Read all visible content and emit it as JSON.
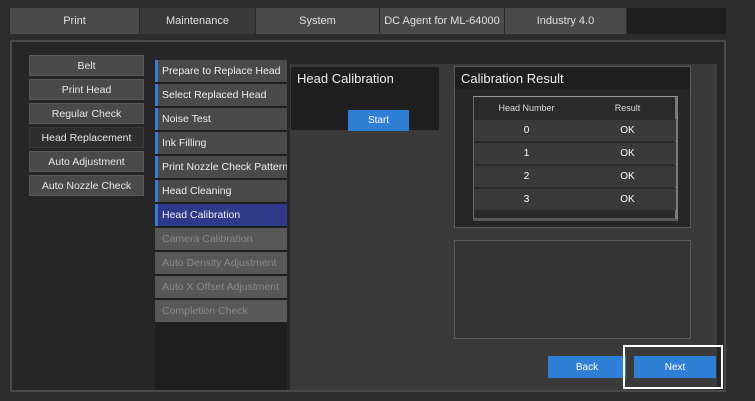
{
  "tabs": [
    {
      "label": "Print",
      "active": false
    },
    {
      "label": "Maintenance",
      "active": true
    },
    {
      "label": "System",
      "active": false
    },
    {
      "label": "DC Agent for ML-64000",
      "active": false
    },
    {
      "label": "Industry 4.0",
      "active": false
    }
  ],
  "sidebar": {
    "items": [
      {
        "label": "Belt"
      },
      {
        "label": "Print Head"
      },
      {
        "label": "Regular Check"
      },
      {
        "label": "Head Replacement",
        "active": true
      },
      {
        "label": "Auto Adjustment"
      },
      {
        "label": "Auto Nozzle Check"
      }
    ]
  },
  "steps": [
    {
      "label": "Prepare to Replace Head",
      "state": "enabled"
    },
    {
      "label": "Select Replaced Head",
      "state": "enabled"
    },
    {
      "label": "Noise Test",
      "state": "enabled"
    },
    {
      "label": "Ink Filling",
      "state": "enabled"
    },
    {
      "label": "Print Nozzle Check Pattern",
      "state": "enabled"
    },
    {
      "label": "Head Cleaning",
      "state": "enabled"
    },
    {
      "label": "Head Calibration",
      "state": "active"
    },
    {
      "label": "Camera Calibration",
      "state": "disabled"
    },
    {
      "label": "Auto Density Adjustment",
      "state": "disabled"
    },
    {
      "label": "Auto X Offset Adjustment",
      "state": "disabled"
    },
    {
      "label": "Completion Check",
      "state": "disabled"
    }
  ],
  "calibration": {
    "title": "Head Calibration",
    "start_label": "Start"
  },
  "result": {
    "title": "Calibration Result",
    "columns": [
      "Head Number",
      "Result"
    ],
    "rows": [
      {
        "head": "0",
        "result": "OK"
      },
      {
        "head": "1",
        "result": "OK"
      },
      {
        "head": "2",
        "result": "OK"
      },
      {
        "head": "3",
        "result": "OK"
      }
    ]
  },
  "footer": {
    "back_label": "Back",
    "next_label": "Next"
  },
  "colors": {
    "accent_blue": "#2f7fd6",
    "active_step": "#2d3a8a",
    "highlight": "#ffffff"
  }
}
